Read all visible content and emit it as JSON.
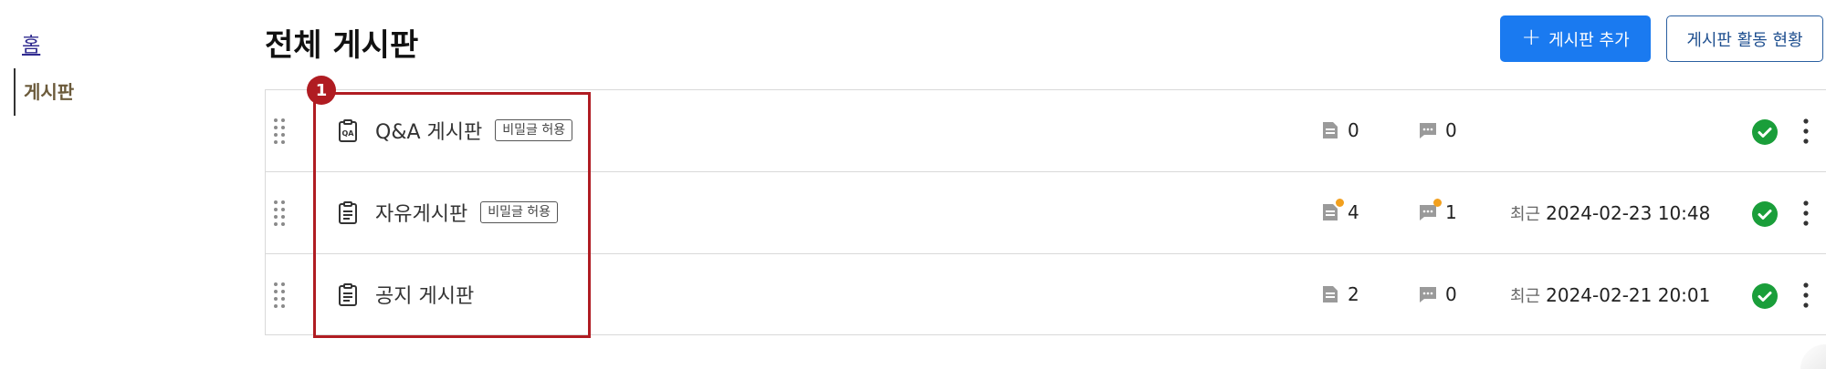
{
  "sidebar": {
    "home_label": "홈",
    "board_label": "게시판"
  },
  "header": {
    "title": "전체 게시판",
    "add_button_label": "게시판 추가",
    "activity_button_label": "게시판 활동 현황"
  },
  "boards": [
    {
      "name": "Q&A 게시판",
      "icon": "qa-board-icon",
      "badge": "비밀글 허용",
      "posts": "0",
      "comments": "0",
      "recent_label": "",
      "recent_time": "",
      "has_new_posts": false,
      "has_new_comments": false
    },
    {
      "name": "자유게시판",
      "icon": "clipboard-icon",
      "badge": "비밀글 허용",
      "posts": "4",
      "comments": "1",
      "recent_label": "최근",
      "recent_time": "2024-02-23 10:48",
      "has_new_posts": true,
      "has_new_comments": true
    },
    {
      "name": "공지 게시판",
      "icon": "clipboard-icon",
      "badge": "",
      "posts": "2",
      "comments": "0",
      "recent_label": "최근",
      "recent_time": "2024-02-21 20:01",
      "has_new_posts": false,
      "has_new_comments": false
    }
  ],
  "annotation": {
    "step_number": "1"
  },
  "colors": {
    "primary": "#1a7af0",
    "annotation": "#b01c22",
    "active_status": "#1a9e3a",
    "new_dot": "#f2a01e"
  }
}
